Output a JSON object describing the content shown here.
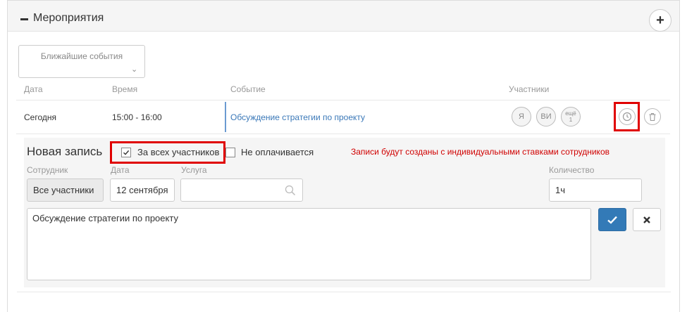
{
  "panel": {
    "title": "Мероприятия",
    "add_label": "+"
  },
  "upcoming": {
    "label": "Ближайшие события",
    "chevron": "⌄"
  },
  "table": {
    "columns": [
      "Дата",
      "Время",
      "Событие",
      "Участники"
    ],
    "row": {
      "date": "Сегодня",
      "time": "15:00 - 16:00",
      "event": "Обсуждение стратегии по проекту",
      "participants": [
        "Я",
        "ВИ"
      ],
      "more_label": "ещё",
      "more_count": "1"
    }
  },
  "new_entry": {
    "title": "Новая запись",
    "all_participants_label": "За всех участников",
    "all_participants_checked": true,
    "not_paid_label": "Не оплачивается",
    "not_paid_checked": false,
    "warning": "Записи будут созданы с индивидуальными ставками сотрудников",
    "employee_label": "Сотрудник",
    "employee_value": "Все участники",
    "date_label": "Дата",
    "date_value": "12 сентября",
    "service_label": "Услуга",
    "service_value": "",
    "quantity_label": "Количество",
    "quantity_value": "1ч",
    "description": "Обсуждение стратегии по проекту"
  },
  "colors": {
    "accent": "#337ab7",
    "warning": "#d00000",
    "highlight": "#e00000"
  }
}
